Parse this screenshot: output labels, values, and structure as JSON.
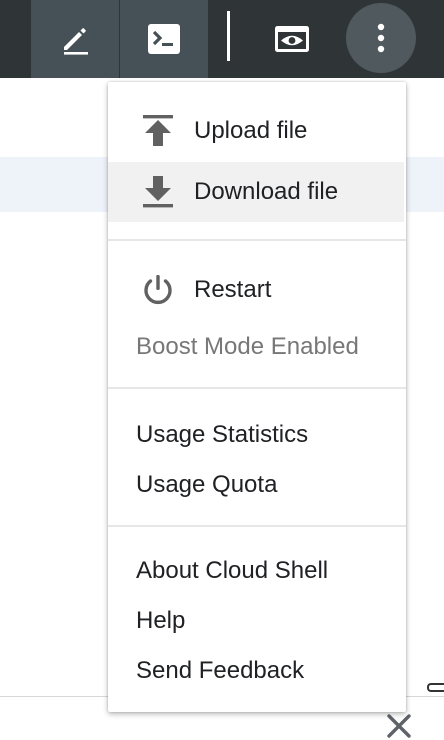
{
  "toolbar": {
    "buttons": [
      {
        "name": "edit",
        "icon": "pencil-icon",
        "active": true
      },
      {
        "name": "terminal",
        "icon": "terminal-icon",
        "active": true
      },
      {
        "name": "web-preview",
        "icon": "eye-icon",
        "active": false
      },
      {
        "name": "more",
        "icon": "more-vertical-icon",
        "active": true
      }
    ]
  },
  "menu": {
    "upload_label": "Upload file",
    "download_label": "Download file",
    "restart_label": "Restart",
    "boost_label": "Boost Mode Enabled",
    "usage_statistics_label": "Usage Statistics",
    "usage_quota_label": "Usage Quota",
    "about_label": "About Cloud Shell",
    "help_label": "Help",
    "feedback_label": "Send Feedback"
  },
  "colors": {
    "toolbar_bg": "#2f3437",
    "toolbar_active": "#465157",
    "menu_highlight": "#f1f1f1",
    "text": "#202124",
    "muted_text": "#777777",
    "icon_gray": "#616161"
  }
}
